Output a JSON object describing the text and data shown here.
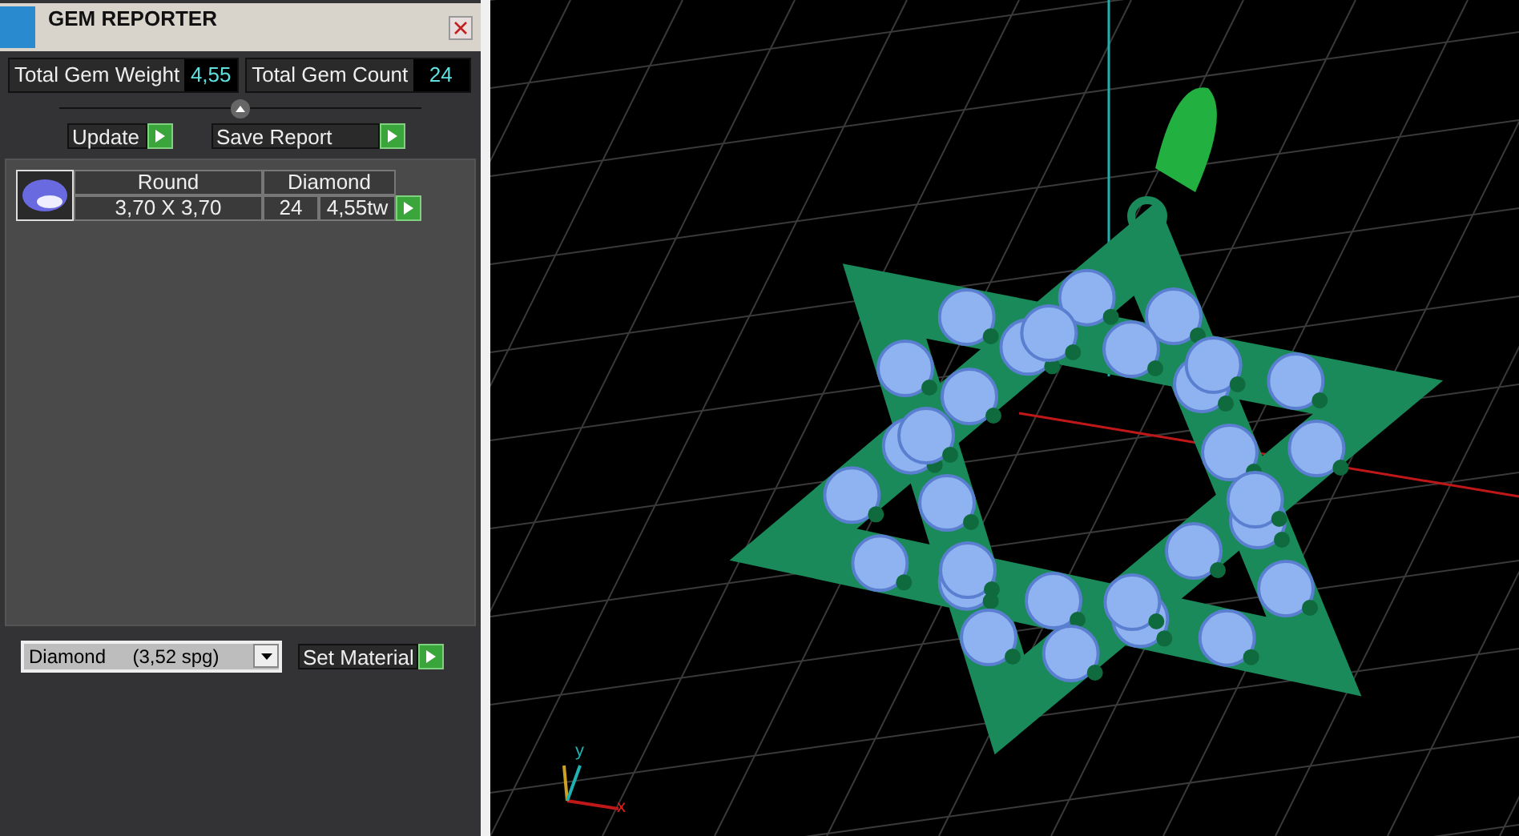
{
  "window": {
    "title": "GEM REPORTER"
  },
  "stats": [
    {
      "label": "Total Gem Weight",
      "value": "4,55"
    },
    {
      "label": "Total Gem Count",
      "value": "24"
    }
  ],
  "actions": [
    "Update",
    "Save Report"
  ],
  "gem_table": {
    "header": [
      "Round",
      "Diamond"
    ],
    "row": {
      "size": "3,70 X 3,70",
      "count": "24",
      "weight": "4,55tw"
    }
  },
  "material": {
    "value": "Diamond     (3,52 spg)",
    "button": "Set Material"
  },
  "viewport": {
    "axis_labels": [
      "y",
      "x"
    ]
  }
}
